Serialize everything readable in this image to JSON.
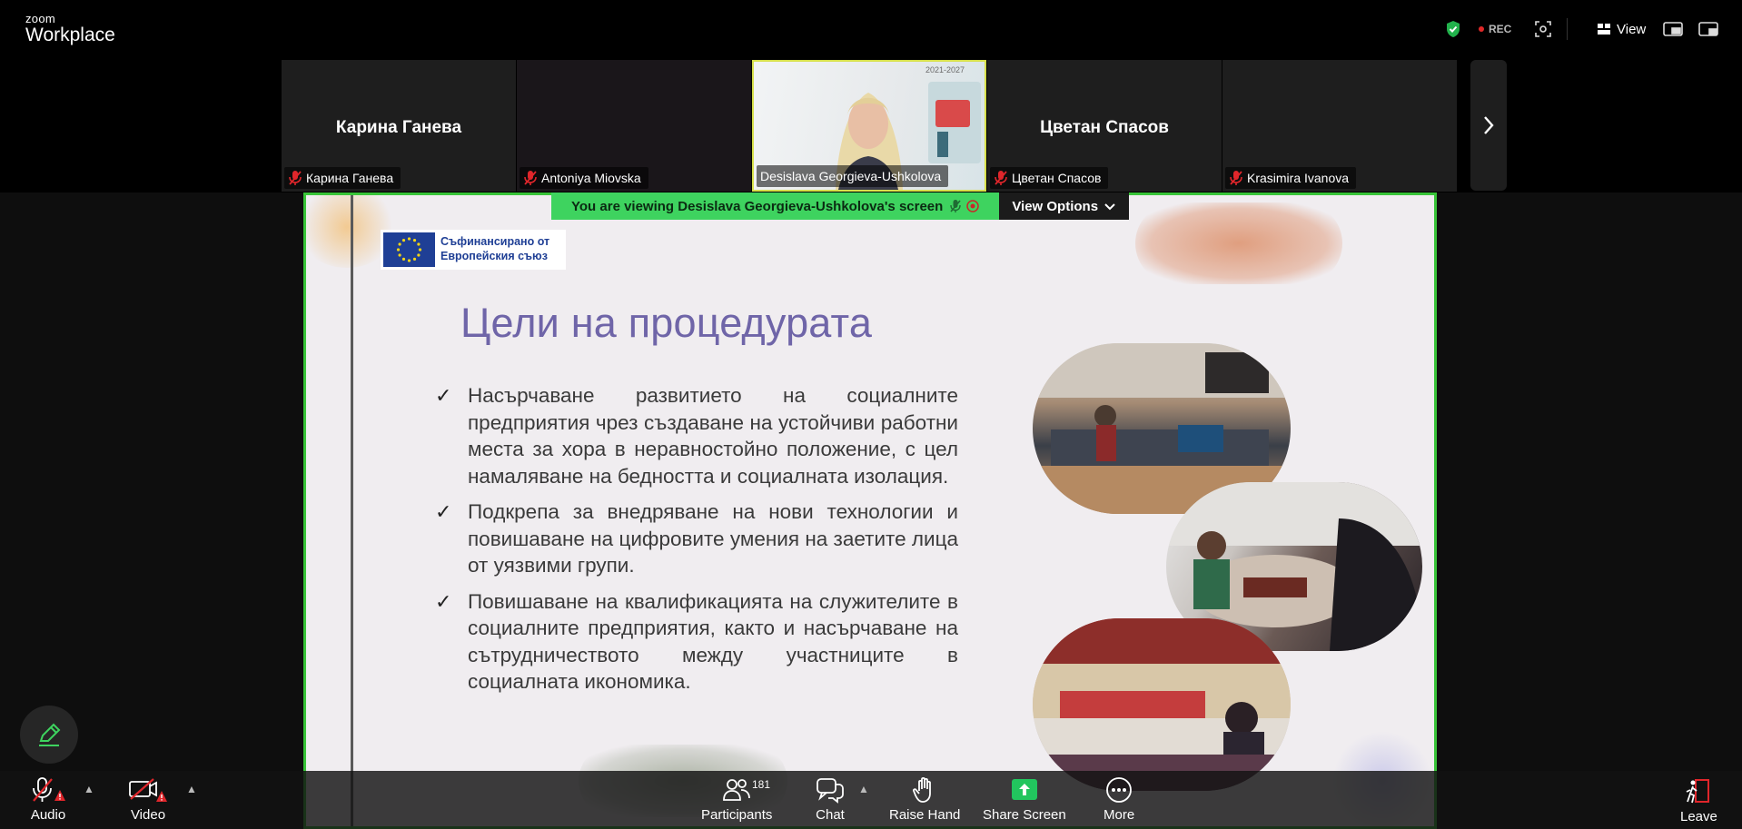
{
  "app": {
    "brand_top": "zoom",
    "brand_bottom": "Workplace"
  },
  "topbar": {
    "rec_label": "REC",
    "view_label": "View"
  },
  "participants_strip": [
    {
      "name": "Карина Ганева",
      "big_name": "Карина Ганева",
      "muted": true
    },
    {
      "name": "Antoniya Miovska",
      "big_name": "",
      "muted": true
    },
    {
      "name": "Desislava Georgieva-Ushkolova",
      "big_name": "",
      "muted": false,
      "poster_text": "2021-2027"
    },
    {
      "name": "Цветан Спасов",
      "big_name": "Цветан Спасов",
      "muted": true
    },
    {
      "name": "Krasimira Ivanova",
      "big_name": "",
      "muted": true
    }
  ],
  "share": {
    "viewing_label": "You are viewing  Desislava Georgieva-Ushkolova's screen",
    "view_options_label": "View Options"
  },
  "slide": {
    "logo_line1": "Съфинансирано от",
    "logo_line2": "Европейския съюз",
    "title": "Цели на процедурата",
    "bullets": [
      "Насърчаване развитието на социалните предприятия чрез създаване на устойчиви работни места за хора в неравностойно положение, с цел намаляване на бедността и социалната изолация.",
      "Подкрепа за внедряване на нови технологии и повишаване на цифровите умения на заетите лица от уязвими групи.",
      "Повишаване на квалификацията на служителите в социалните предприятия, както и насърчаване на сътрудничеството между участниците в социалната икономика."
    ]
  },
  "toolbar": {
    "audio": "Audio",
    "video": "Video",
    "participants": "Participants",
    "participants_count": "181",
    "chat": "Chat",
    "raise_hand": "Raise Hand",
    "share_screen": "Share Screen",
    "more": "More",
    "leave": "Leave"
  },
  "colors": {
    "share_green": "#3ed35f",
    "slide_border": "#38c438",
    "title_purple": "#6f65a8",
    "muted_red": "#e0262b",
    "eu_blue": "#1f3f95",
    "leave_red": "#e0262b"
  },
  "icons": [
    "shield-icon",
    "focus-icon",
    "grid-icon",
    "pip-icon",
    "minimize-icon",
    "chevron-right-icon",
    "mic-muted-icon",
    "camera-off-icon",
    "participants-icon",
    "chat-icon",
    "hand-icon",
    "share-arrow-icon",
    "more-icon",
    "leave-icon",
    "pencil-icon"
  ]
}
